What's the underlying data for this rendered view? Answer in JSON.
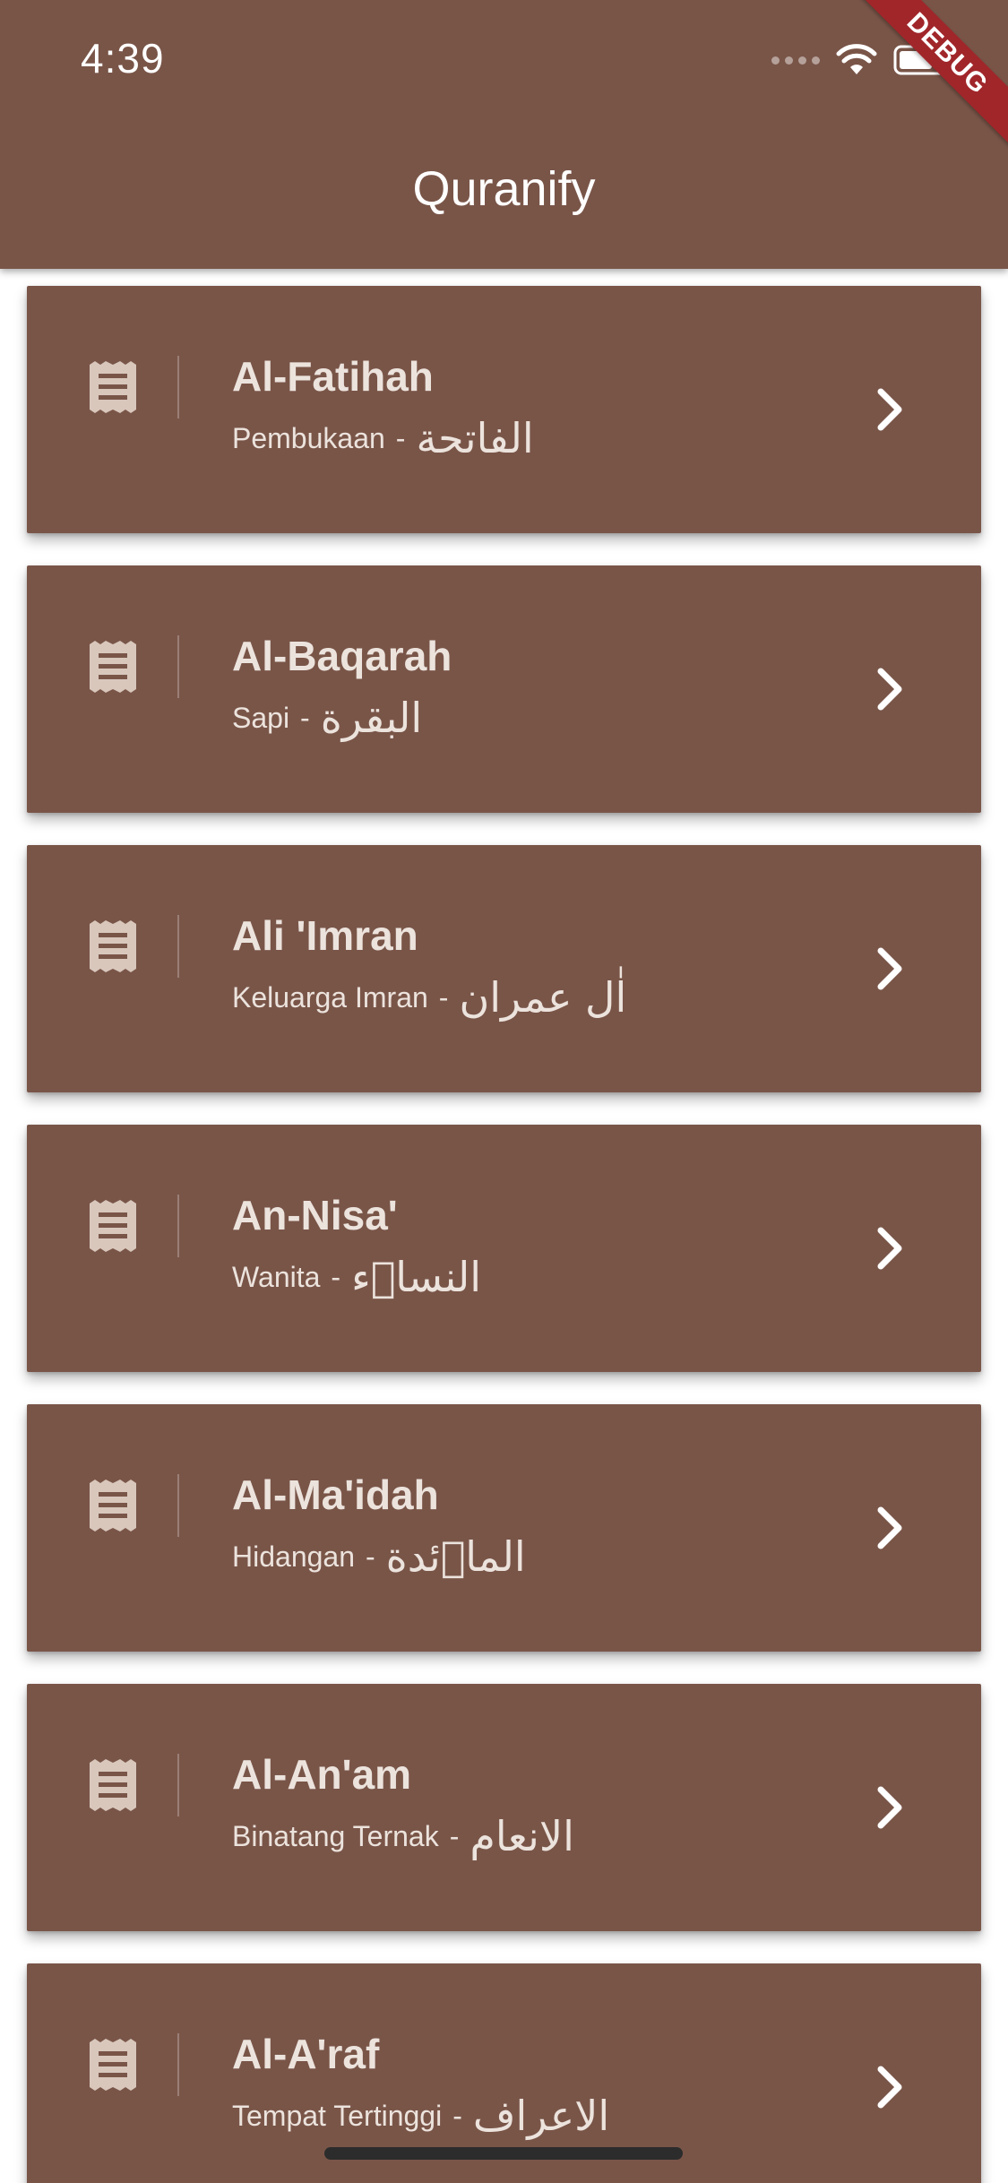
{
  "status_bar": {
    "time": "4:39",
    "icons": [
      "signal-icon",
      "wifi-icon",
      "battery-icon"
    ]
  },
  "debug_banner": "DEBUG",
  "app_bar": {
    "title": "Quranify"
  },
  "colors": {
    "primary": "#795548",
    "card_text": "#ece3dd",
    "debug": "#a0262a"
  },
  "surahs": [
    {
      "name": "Al-Fatihah",
      "meaning": "Pembukaan",
      "separator": "-",
      "arabic": "الفاتحة"
    },
    {
      "name": "Al-Baqarah",
      "meaning": "Sapi",
      "separator": "-",
      "arabic": "البقرة"
    },
    {
      "name": "Ali 'Imran",
      "meaning": "Keluarga Imran",
      "separator": "-",
      "arabic": "اٰل عمران"
    },
    {
      "name": "An-Nisa'",
      "meaning": "Wanita",
      "separator": "-",
      "arabic": "النساۤء"
    },
    {
      "name": "Al-Ma'idah",
      "meaning": "Hidangan",
      "separator": "-",
      "arabic": "الماۤئدة"
    },
    {
      "name": "Al-An'am",
      "meaning": "Binatang Ternak",
      "separator": "-",
      "arabic": "الانعام"
    },
    {
      "name": "Al-A'raf",
      "meaning": "Tempat Tertinggi",
      "separator": "-",
      "arabic": "الاعراف"
    }
  ]
}
